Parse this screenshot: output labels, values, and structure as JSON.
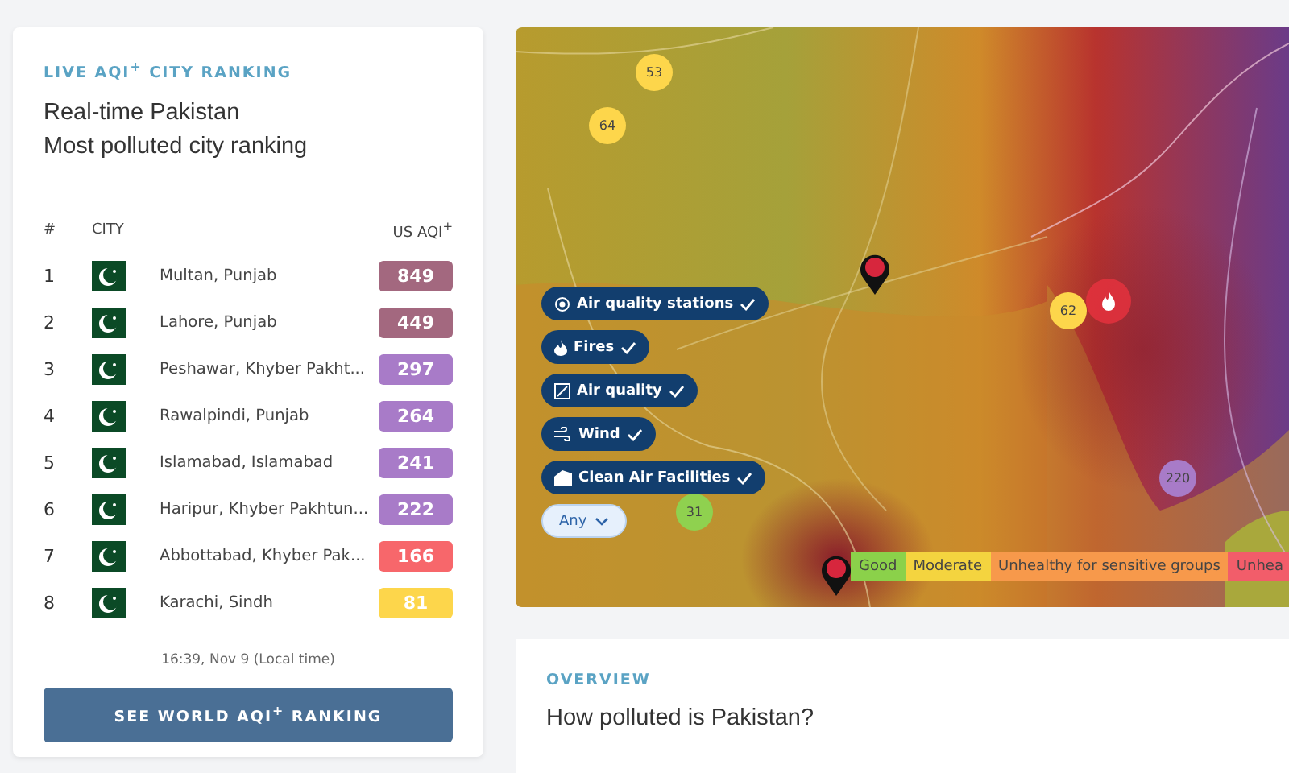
{
  "ranking": {
    "eyebrow": "LIVE AQI$^{+}$ CITY RANKING",
    "title_lines": [
      "Real-time Pakistan",
      "Most polluted city ranking"
    ],
    "columns": [
      "#",
      "CITY",
      "US AQI$^{+}$"
    ],
    "rows": [
      {
        "rank": "1",
        "city": "Multan, Punjab",
        "aqi": "849",
        "color": "#a3687f"
      },
      {
        "rank": "2",
        "city": "Lahore, Punjab",
        "aqi": "449",
        "color": "#a3687f"
      },
      {
        "rank": "3",
        "city": "Peshawar, Khyber Pakht...",
        "aqi": "297",
        "color": "#a87bc8"
      },
      {
        "rank": "4",
        "city": "Rawalpindi, Punjab",
        "aqi": "264",
        "color": "#a87bc8"
      },
      {
        "rank": "5",
        "city": "Islamabad, Islamabad",
        "aqi": "241",
        "color": "#a87bc8"
      },
      {
        "rank": "6",
        "city": "Haripur, Khyber Pakhtun...",
        "aqi": "222",
        "color": "#a87bc8"
      },
      {
        "rank": "7",
        "city": "Abbottabad, Khyber Pak...",
        "aqi": "166",
        "color": "#f7676b"
      },
      {
        "rank": "8",
        "city": "Karachi, Sindh",
        "aqi": "81",
        "color": "#fdd64b"
      }
    ],
    "timestamp": "16:39, Nov 9 (Local time)",
    "button": "SEE WORLD AQI$^{+}$ RANKING"
  },
  "map": {
    "kind": "picture",
    "stations": [
      {
        "aqi": "53",
        "color": "#fdd64b"
      },
      {
        "aqi": "64",
        "color": "#fdd64b"
      },
      {
        "aqi": "62",
        "color": "#fdd64b"
      },
      {
        "aqi": "31",
        "color": "#8fd14f"
      },
      {
        "aqi": "220",
        "color": "#a87bc8"
      }
    ],
    "layers": [
      {
        "label": "Air quality stations",
        "kind": "stations",
        "checked": true
      },
      {
        "label": "Fires",
        "kind": "fire",
        "checked": true
      },
      {
        "label": "Air quality",
        "kind": "air",
        "checked": true
      },
      {
        "label": "Wind",
        "kind": "wind",
        "checked": true
      },
      {
        "label": "Clean Air Facilities",
        "kind": "facility",
        "checked": true
      }
    ],
    "filter": "Any",
    "legend": [
      {
        "label": "Good",
        "color": "#8bd14a"
      },
      {
        "label": "Moderate",
        "color": "#f4d43f"
      },
      {
        "label": "Unhealthy for sensitive groups",
        "color": "#f7994b"
      },
      {
        "label": "Unhea",
        "color": "#f25d6a"
      }
    ]
  },
  "overview": {
    "eyebrow": "OVERVIEW",
    "title": "How polluted is Pakistan?"
  }
}
